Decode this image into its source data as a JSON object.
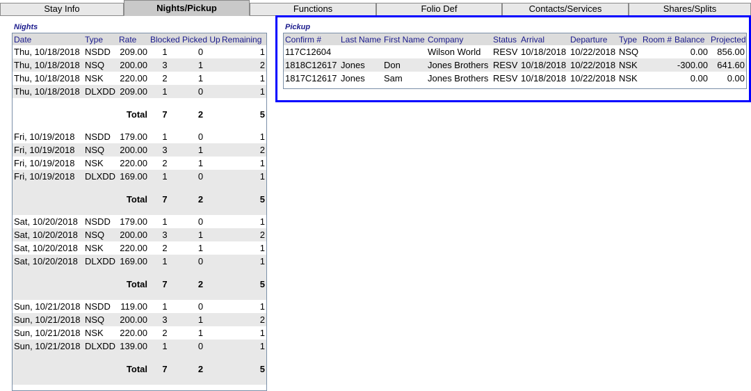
{
  "tabs": [
    {
      "label": "Stay Info",
      "active": false
    },
    {
      "label": "Nights/Pickup",
      "active": true
    },
    {
      "label": "Functions",
      "active": false
    },
    {
      "label": "Folio Def",
      "active": false
    },
    {
      "label": "Contacts/Services",
      "active": false
    },
    {
      "label": "Shares/Splits",
      "active": false
    }
  ],
  "nights": {
    "title": "Nights",
    "headers": [
      "Date",
      "Type",
      "Rate",
      "Blocked",
      "Picked Up",
      "Remaining"
    ],
    "total_label": "Total",
    "groups": [
      {
        "rows": [
          [
            "Thu, 10/18/2018",
            "NSDD",
            "209.00",
            "1",
            "0",
            "1"
          ],
          [
            "Thu, 10/18/2018",
            "NSQ",
            "200.00",
            "3",
            "1",
            "2"
          ],
          [
            "Thu, 10/18/2018",
            "NSK",
            "220.00",
            "2",
            "1",
            "1"
          ],
          [
            "Thu, 10/18/2018",
            "DLXDD",
            "209.00",
            "1",
            "0",
            "1"
          ]
        ],
        "total": [
          "7",
          "2",
          "5"
        ]
      },
      {
        "rows": [
          [
            "Fri, 10/19/2018",
            "NSDD",
            "179.00",
            "1",
            "0",
            "1"
          ],
          [
            "Fri, 10/19/2018",
            "NSQ",
            "200.00",
            "3",
            "1",
            "2"
          ],
          [
            "Fri, 10/19/2018",
            "NSK",
            "220.00",
            "2",
            "1",
            "1"
          ],
          [
            "Fri, 10/19/2018",
            "DLXDD",
            "169.00",
            "1",
            "0",
            "1"
          ]
        ],
        "total": [
          "7",
          "2",
          "5"
        ]
      },
      {
        "rows": [
          [
            "Sat, 10/20/2018",
            "NSDD",
            "179.00",
            "1",
            "0",
            "1"
          ],
          [
            "Sat, 10/20/2018",
            "NSQ",
            "200.00",
            "3",
            "1",
            "2"
          ],
          [
            "Sat, 10/20/2018",
            "NSK",
            "220.00",
            "2",
            "1",
            "1"
          ],
          [
            "Sat, 10/20/2018",
            "DLXDD",
            "169.00",
            "1",
            "0",
            "1"
          ]
        ],
        "total": [
          "7",
          "2",
          "5"
        ]
      },
      {
        "rows": [
          [
            "Sun, 10/21/2018",
            "NSDD",
            "119.00",
            "1",
            "0",
            "1"
          ],
          [
            "Sun, 10/21/2018",
            "NSQ",
            "200.00",
            "3",
            "1",
            "2"
          ],
          [
            "Sun, 10/21/2018",
            "NSK",
            "220.00",
            "2",
            "1",
            "1"
          ],
          [
            "Sun, 10/21/2018",
            "DLXDD",
            "139.00",
            "1",
            "0",
            "1"
          ]
        ],
        "total": [
          "7",
          "2",
          "5"
        ]
      }
    ]
  },
  "pickup": {
    "title": "Pickup",
    "headers": [
      "Confirm #",
      "Last Name",
      "First Name",
      "Company",
      "Status",
      "Arrival",
      "Departure",
      "Type",
      "Room #",
      "Balance",
      "Projected"
    ],
    "rows": [
      [
        "117C12604",
        "",
        "",
        "Wilson World",
        "RESV",
        "10/18/2018",
        "10/22/2018",
        "NSQ",
        "",
        "0.00",
        "856.00"
      ],
      [
        "1818C12617",
        "Jones",
        "Don",
        "Jones Brothers",
        "RESV",
        "10/18/2018",
        "10/22/2018",
        "NSK",
        "",
        "-300.00",
        "641.60"
      ],
      [
        "1817C12617",
        "Jones",
        "Sam",
        "Jones Brothers",
        "RESV",
        "10/18/2018",
        "10/22/2018",
        "NSK",
        "",
        "0.00",
        "0.00"
      ]
    ]
  },
  "colors": {
    "highlight": "#0000ff",
    "header_text": "#1a1a8c",
    "active_tab": "#c9c9c9",
    "row_alt": "#e8e8e8"
  }
}
